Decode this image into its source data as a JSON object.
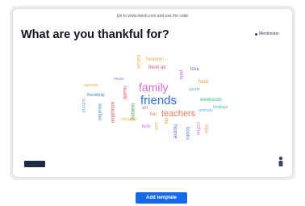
{
  "slide": {
    "join_text": "Go to www.menti.com and use the code",
    "question": "What are you thankful for?",
    "participants_label": "Mentimeter"
  },
  "word_cloud": [
    {
      "text": "family",
      "color": "#d86ad2"
    },
    {
      "text": "friends",
      "color": "#2f6be3"
    },
    {
      "text": "teachers",
      "color": "#ee7a5e"
    },
    {
      "text": "freedom",
      "color": "#f3a54c"
    },
    {
      "text": "fresh air",
      "color": "#e15757"
    },
    {
      "text": "music",
      "color": "#7a8bd6"
    },
    {
      "text": "summer",
      "color": "#f2b34a"
    },
    {
      "text": "food",
      "color": "#e59a3a"
    },
    {
      "text": "sports",
      "color": "#4cc0b0"
    },
    {
      "text": "weekends",
      "color": "#2ec27e"
    },
    {
      "text": "health",
      "color": "#e55b6c"
    },
    {
      "text": "pets",
      "color": "#c65bd6"
    },
    {
      "text": "art",
      "color": "#e56a8a"
    },
    {
      "text": "love",
      "color": "#7b5fe0"
    },
    {
      "text": "life",
      "color": "#f0a040"
    },
    {
      "text": "home",
      "color": "#6b7cd8"
    },
    {
      "text": "nature",
      "color": "#f0b040"
    },
    {
      "text": "learning",
      "color": "#5aa05a"
    },
    {
      "text": "education",
      "color": "#d9534f"
    },
    {
      "text": "weather",
      "color": "#4f8fe0"
    },
    {
      "text": "coffee",
      "color": "#e07ac0"
    },
    {
      "text": "sun",
      "color": "#e8b040"
    },
    {
      "text": "books",
      "color": "#5d7ad6"
    },
    {
      "text": "fun",
      "color": "#f08050"
    },
    {
      "text": "kids",
      "color": "#d06bd0"
    },
    {
      "text": "school",
      "color": "#7aa7e8"
    },
    {
      "text": "trips",
      "color": "#e8a05a"
    },
    {
      "text": "friendship",
      "color": "#3f7de0"
    },
    {
      "text": "animals",
      "color": "#6ab0e0"
    },
    {
      "text": "sunshine",
      "color": "#f0c04a"
    },
    {
      "text": "holidays",
      "color": "#4ab8a8"
    }
  ],
  "footer": {
    "add_template_label": "Add template"
  }
}
